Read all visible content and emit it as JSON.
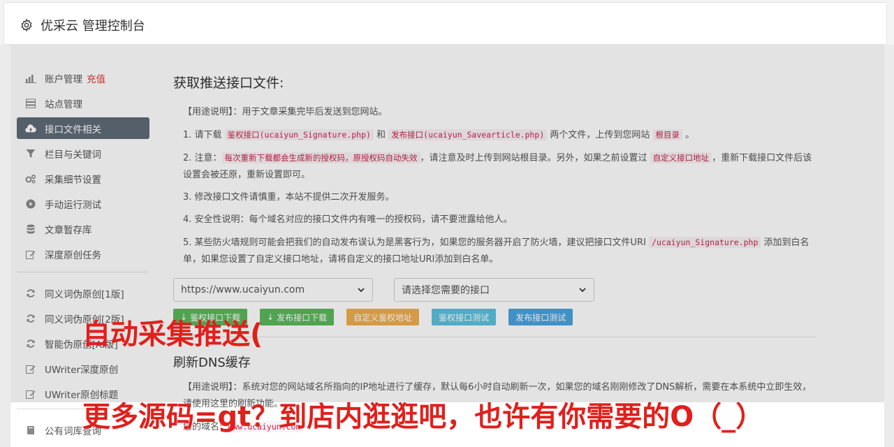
{
  "header": {
    "title": "优采云 管理控制台"
  },
  "sidebar": {
    "items": [
      {
        "label": "账户管理",
        "extra": "充值",
        "icon": "bar-chart-icon"
      },
      {
        "label": "站点管理",
        "icon": "server-icon"
      },
      {
        "label": "接口文件相关",
        "icon": "cloud-upload-icon",
        "active": true
      },
      {
        "label": "栏目与关键词",
        "icon": "filter-icon"
      },
      {
        "label": "采集细节设置",
        "icon": "cogs-icon"
      },
      {
        "label": "手动运行测试",
        "icon": "play-circle-icon"
      },
      {
        "label": "文章暂存库",
        "icon": "database-icon"
      },
      {
        "label": "深度原创任务",
        "icon": "edit-icon"
      }
    ],
    "items2": [
      {
        "label": "同义词伪原创[1版]",
        "icon": "refresh-icon"
      },
      {
        "label": "同义词伪原创[2版]",
        "icon": "refresh-icon"
      },
      {
        "label": "智能伪原创[AI版]",
        "icon": "refresh-icon"
      },
      {
        "label": "UWriter深度原创",
        "icon": "edit-icon"
      },
      {
        "label": "UWriter原创标题",
        "icon": "edit-icon"
      }
    ],
    "items3": [
      {
        "label": "公有词库查询",
        "icon": "book-icon"
      }
    ]
  },
  "main": {
    "title": "获取推送接口文件:",
    "usage_label": "【用途说明】",
    "usage_text": "：用于文章采集完毕后发送到您网站。",
    "p1": {
      "a": "1. 请下载 ",
      "code1": "鉴权接口(ucaiyun_Signature.php)",
      "b": " 和 ",
      "code2": "发布接口(ucaiyun_Savearticle.php)",
      "c": " 两个文件，上传到您网站 ",
      "code3": "根目录",
      "d": " 。"
    },
    "p2": {
      "a": "2. 注意：",
      "code1": "每次重新下载都会生成新的授权码，原授权码自动失效",
      "b": "，请注意及时上传到网站根目录。另外，如果之前设置过 ",
      "code2": "自定义接口地址",
      "c": "，重新下载接口文件后该设置会被还原，重新设置即可。"
    },
    "p3": "3. 修改接口文件请慎重，本站不提供二次开发服务。",
    "p4": "4. 安全性说明：每个域名对应的接口文件内有唯一的授权码，请不要泄露给他人。",
    "p5": {
      "a": "5. 某些防火墙规则可能会把我们的自动发布误认为是黑客行为，如果您的服务器开启了防火墙，建议把接口文件URI ",
      "code1": "/ucaiyun_Signature.php",
      "b": " 添加到白名单，如果您设置了自定义接口地址，请将自定义的接口地址URI添加到白名单。"
    },
    "select_site": "https://www.ucaiyun.com",
    "select_api": "请选择您需要的接口",
    "buttons": {
      "sign_download": "鉴权接口下载",
      "publish_download": "发布接口下载",
      "custom": "自定义鉴权地址",
      "sign_test": "鉴权接口测试",
      "publish_test": "发布接口测试"
    },
    "dns_title": "刷新DNS缓存",
    "dns_usage": "【用途说明】：系统对您的网站域名所指向的IP地址进行了缓存，默认每6小时自动刷新一次，如果您的域名刚刚修改了DNS解析，需要在本系统中立即生效，请使用这里的刷新功能。",
    "domain_label": "您的域名:",
    "domain_value": "www.ucaiyun.com"
  },
  "watermark": {
    "line1": "自动采集推送(",
    "line2": "更多源码=gt？到店内逛逛吧，也许有你需要的O（_）"
  },
  "colors": {
    "active_bg": "#5f6b78",
    "accent_red": "#e0342f",
    "code_red": "#c7254e"
  }
}
